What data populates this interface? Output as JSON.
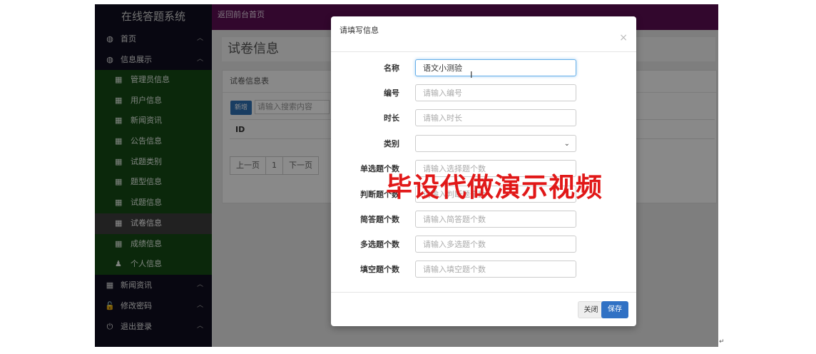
{
  "app": {
    "brand": "在线答题系统",
    "topbar_link": "返回前台首页"
  },
  "sidebar": {
    "top_items": [
      {
        "icon": "dashboard-icon",
        "glyph": "◍",
        "label": "首页"
      },
      {
        "icon": "dashboard-icon",
        "glyph": "◍",
        "label": "信息展示"
      }
    ],
    "sub_items": [
      {
        "icon": "table-icon",
        "label": "管理员信息",
        "active": false
      },
      {
        "icon": "table-icon",
        "label": "用户信息",
        "active": false
      },
      {
        "icon": "table-icon",
        "label": "新闻资讯",
        "active": false
      },
      {
        "icon": "table-icon",
        "label": "公告信息",
        "active": false
      },
      {
        "icon": "table-icon",
        "label": "试题类别",
        "active": false
      },
      {
        "icon": "table-icon",
        "label": "题型信息",
        "active": false
      },
      {
        "icon": "table-icon",
        "label": "试题信息",
        "active": false
      },
      {
        "icon": "table-icon",
        "label": "试卷信息",
        "active": true
      },
      {
        "icon": "table-icon",
        "label": "成绩信息",
        "active": false
      },
      {
        "icon": "user-icon",
        "label": "个人信息",
        "active": false
      }
    ],
    "bottom_items": [
      {
        "icon": "table-icon",
        "glyph": "▦",
        "label": "新闻资讯"
      },
      {
        "icon": "lock-icon",
        "glyph": "🔓",
        "label": "修改密码"
      },
      {
        "icon": "power-icon",
        "glyph": "⏻",
        "label": "退出登录"
      }
    ]
  },
  "main": {
    "page_title": "试卷信息",
    "panel_title": "试卷信息表",
    "add_button": "新增",
    "search_placeholder": "请输入搜索内容",
    "table_header_first": "ID",
    "pager": {
      "prev": "上一页",
      "page": "1",
      "next": "下一页"
    }
  },
  "modal": {
    "title": "请填写信息",
    "close_glyph": "×",
    "fields": [
      {
        "label": "名称",
        "value": "语文小测验",
        "placeholder": "",
        "type": "text"
      },
      {
        "label": "编号",
        "value": "",
        "placeholder": "请输入编号",
        "type": "text"
      },
      {
        "label": "时长",
        "value": "",
        "placeholder": "请输入时长",
        "type": "text"
      },
      {
        "label": "类别",
        "value": "",
        "placeholder": "",
        "type": "select"
      },
      {
        "label": "单选题个数",
        "value": "",
        "placeholder": "请输入选择题个数",
        "type": "text"
      },
      {
        "label": "判断题个数",
        "value": "",
        "placeholder": "请输入判断题个数",
        "type": "text"
      },
      {
        "label": "简答题个数",
        "value": "",
        "placeholder": "请输入简答题个数",
        "type": "text"
      },
      {
        "label": "多选题个数",
        "value": "",
        "placeholder": "请输入多选题个数",
        "type": "text"
      },
      {
        "label": "填空题个数",
        "value": "",
        "placeholder": "请输入填空题个数",
        "type": "text"
      }
    ],
    "close_button": "关闭",
    "save_button": "保存"
  },
  "watermark": "毕设代做演示视频",
  "colors": {
    "sidebar_bg": "#0f0d1f",
    "submenu_bg": "#154a15",
    "topbar_bg": "#5b0d52",
    "primary": "#3071c4",
    "watermark": "#e11818"
  }
}
